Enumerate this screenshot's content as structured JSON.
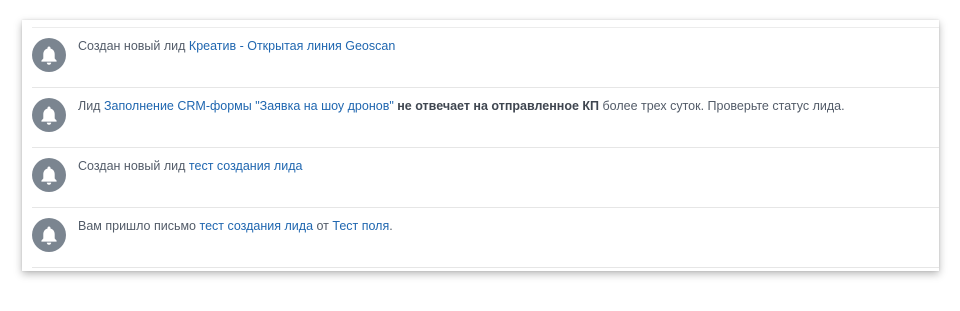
{
  "notifications": [
    {
      "icon": "bell-icon",
      "prefix": "Создан новый лид ",
      "link": "Креатив - Открытая линия Geoscan"
    },
    {
      "icon": "bell-icon",
      "prefix": "Лид ",
      "link": "Заполнение CRM-формы \"Заявка на шоу дронов\"",
      "bold": " не отвечает на отправленное КП",
      "suffix": " более трех суток. Проверьте статус лида."
    },
    {
      "icon": "bell-icon",
      "prefix": "Создан новый лид ",
      "link": "тест создания лида"
    },
    {
      "icon": "bell-icon",
      "prefix": "Вам пришло письмо ",
      "link": "тест создания лида",
      "middle": " от ",
      "link2": "Тест поля",
      "suffix": "."
    }
  ],
  "colors": {
    "link": "#2067b0",
    "text": "#535c69",
    "avatar": "#7b8590"
  }
}
